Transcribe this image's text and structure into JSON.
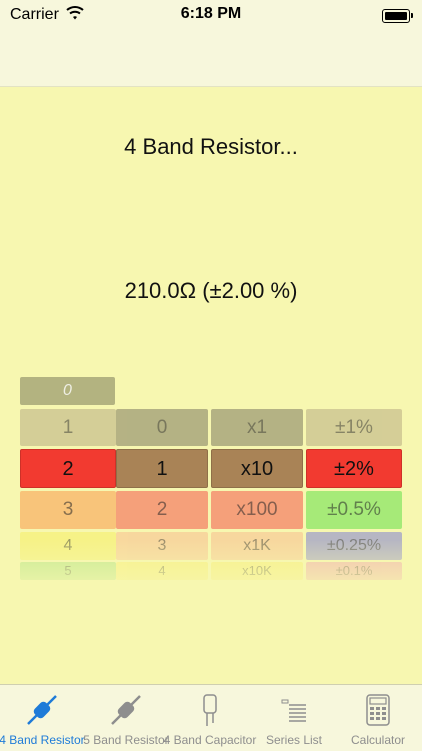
{
  "status": {
    "carrier": "Carrier",
    "time": "6:18 PM"
  },
  "main": {
    "title": "4 Band Resistor...",
    "value": "210.0Ω (±2.00 %)"
  },
  "picker": {
    "bands": [
      {
        "id": "band1",
        "items": [
          {
            "label": "0",
            "color": "#a8a878",
            "state": "above"
          },
          {
            "label": "1",
            "color": "#cfc793",
            "state": "above"
          },
          {
            "label": "2",
            "color": "#f23a30",
            "state": "selected"
          },
          {
            "label": "3",
            "color": "#f8c47a",
            "state": "below"
          },
          {
            "label": "4",
            "color": "#f6f27e",
            "state": "below"
          },
          {
            "label": "5",
            "color": "#b8e68a",
            "state": "below"
          }
        ]
      },
      {
        "id": "band2",
        "items": [
          {
            "label": "0",
            "color": "#a9a67d",
            "state": "above"
          },
          {
            "label": "1",
            "color": "#a98356",
            "state": "selected"
          },
          {
            "label": "2",
            "color": "#f5a07a",
            "state": "below"
          },
          {
            "label": "3",
            "color": "#f8d09a",
            "state": "below"
          },
          {
            "label": "4",
            "color": "#f7ef7e",
            "state": "below"
          }
        ]
      },
      {
        "id": "multiplier",
        "items": [
          {
            "label": "x1",
            "color": "#a9a67d",
            "state": "above"
          },
          {
            "label": "x10",
            "color": "#a98356",
            "state": "selected"
          },
          {
            "label": "x100",
            "color": "#f5a07a",
            "state": "below"
          },
          {
            "label": "x1K",
            "color": "#f8d09a",
            "state": "below"
          },
          {
            "label": "x10K",
            "color": "#f7ef7e",
            "state": "below"
          }
        ]
      },
      {
        "id": "tolerance",
        "items": [
          {
            "label": "±1%",
            "color": "#cfc793",
            "state": "above"
          },
          {
            "label": "±2%",
            "color": "#f23a30",
            "state": "selected"
          },
          {
            "label": "±0.5%",
            "color": "#a6ea78",
            "state": "below"
          },
          {
            "label": "±0.25%",
            "color": "#a7a7c8",
            "state": "below"
          },
          {
            "label": "±0.1%",
            "color": "#f0b0b0",
            "state": "below"
          }
        ]
      }
    ]
  },
  "tabbar": {
    "tabs": [
      {
        "label": "4 Band Resistor",
        "icon": "resistor-icon",
        "active": true
      },
      {
        "label": "5 Band Resistor",
        "icon": "resistor-icon",
        "active": false
      },
      {
        "label": "4 Band Capacitor",
        "icon": "capacitor-icon",
        "active": false
      },
      {
        "label": "Series List",
        "icon": "list-icon",
        "active": false
      },
      {
        "label": "Calculator",
        "icon": "calculator-icon",
        "active": false
      }
    ]
  }
}
